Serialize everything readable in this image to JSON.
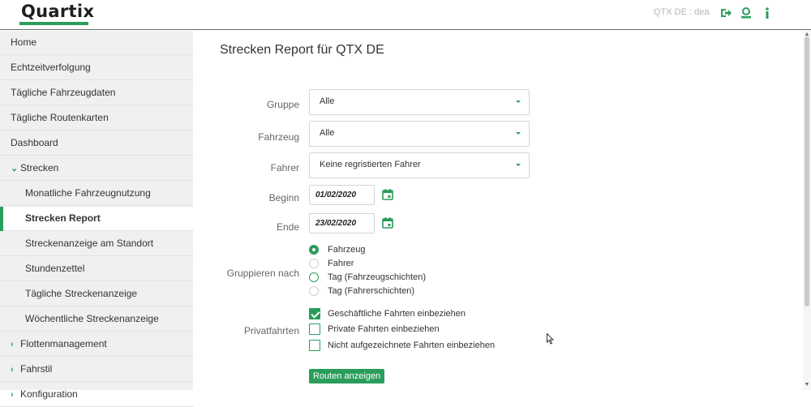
{
  "header": {
    "logo_text": "Quartix",
    "account": "QTX DE : dea",
    "icons": [
      "logout-icon",
      "user-icon",
      "info-icon"
    ],
    "accent": "#2a9d5b"
  },
  "sidebar": {
    "items": [
      {
        "label": "Home"
      },
      {
        "label": "Echtzeitverfolgung"
      },
      {
        "label": "Tägliche Fahrzeugdaten"
      },
      {
        "label": "Tägliche Routenkarten"
      },
      {
        "label": "Dashboard"
      },
      {
        "label": "Strecken",
        "expanded": true
      },
      {
        "label": "Monatliche Fahrzeugnutzung"
      },
      {
        "label": "Strecken Report",
        "active": true
      },
      {
        "label": "Streckenanzeige am Standort"
      },
      {
        "label": "Stundenzettel"
      },
      {
        "label": "Tägliche Streckenanzeige"
      },
      {
        "label": "Wöchentliche Streckenanzeige"
      },
      {
        "label": "Flottenmanagement",
        "expanded": false
      },
      {
        "label": "Fahrstil",
        "expanded": false
      },
      {
        "label": "Konfiguration",
        "expanded": false
      }
    ]
  },
  "main": {
    "title": "Strecken Report für QTX DE",
    "form": {
      "group_label": "Gruppe",
      "group_value": "Alle",
      "vehicle_label": "Fahrzeug",
      "vehicle_value": "Alle",
      "driver_label": "Fahrer",
      "driver_value": "Keine regristierten Fahrer",
      "start_label": "Beginn",
      "start_value": "01/02/2020",
      "end_label": "Ende",
      "end_value": "23/02/2020",
      "groupby_label": "Gruppieren nach",
      "groupby_options": [
        {
          "label": "Fahrzeug",
          "selected": true
        },
        {
          "label": "Fahrer",
          "selected": false
        },
        {
          "label": "Tag (Fahrzeugschichten)",
          "selected": false
        },
        {
          "label": "Tag (Fahrerschichten)",
          "selected": false
        }
      ],
      "private_label": "Privatfahrten",
      "private_options": [
        {
          "label": "Geschäftliche Fahrten einbeziehen",
          "checked": true
        },
        {
          "label": "Private Fahrten einbeziehen",
          "checked": false
        },
        {
          "label": "Nicht aufgezeichnete Fahrten einbeziehen",
          "checked": false
        }
      ],
      "submit_label": "Routen anzeigen"
    }
  }
}
